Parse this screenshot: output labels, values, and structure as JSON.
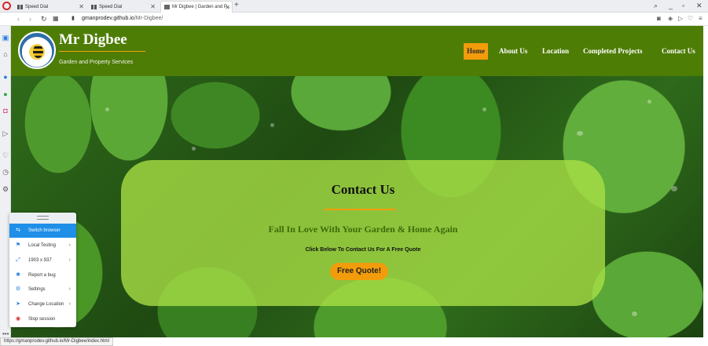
{
  "browser": {
    "tabs": [
      {
        "label": "Speed Dial"
      },
      {
        "label": "Speed Dial"
      },
      {
        "label": "Mr Digbee | Garden and P..."
      }
    ],
    "url_domain": "gmanprodev.github.io",
    "url_path": "/Mr-Digbee/"
  },
  "site": {
    "brand": "Mr Digbee",
    "tagline": "Garden and Property Services",
    "nav": [
      "Home",
      "About Us",
      "Location",
      "Completed Projects",
      "Contact Us"
    ]
  },
  "hero": {
    "title": "Contact Us",
    "subtitle": "Fall In Love With Your Garden & Home Again",
    "note": "Click Below To Contact Us For A Free Quote",
    "button": "Free Quote!"
  },
  "bspanel": {
    "items": [
      {
        "label": "Switch browser",
        "icon": "switch-icon"
      },
      {
        "label": "Local Testing",
        "icon": "local-testing-icon"
      },
      {
        "label": "1903 x 937",
        "icon": "resolution-icon"
      },
      {
        "label": "Report a bug",
        "icon": "bug-icon"
      },
      {
        "label": "Settings",
        "icon": "gear-icon"
      },
      {
        "label": "Change Location",
        "icon": "location-icon"
      },
      {
        "label": "Stop session",
        "icon": "stop-icon"
      }
    ]
  },
  "status": {
    "url": "https://gmanprodev.github.io/Mr-Digbee/index.html"
  }
}
